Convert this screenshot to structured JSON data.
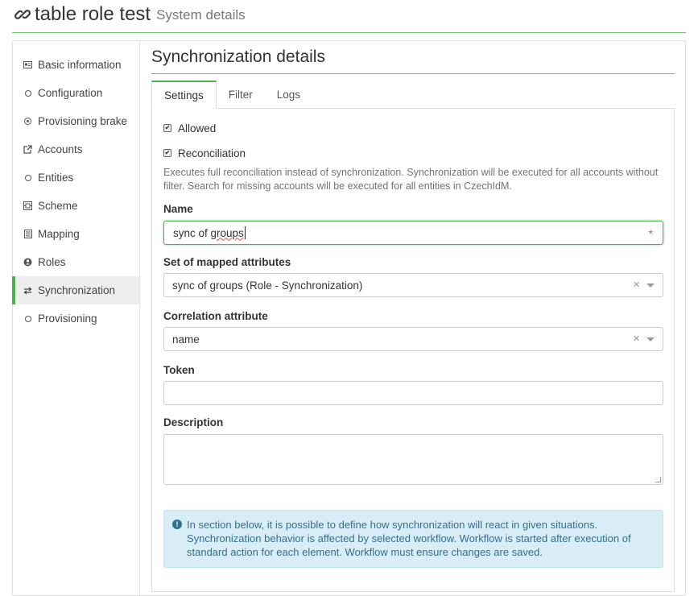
{
  "header": {
    "title": "table role test",
    "subtitle": "System details",
    "icon": "link-icon"
  },
  "sidebar": {
    "items": [
      {
        "label": "Basic information",
        "icon": "id-card-icon"
      },
      {
        "label": "Configuration",
        "icon": "circle-icon"
      },
      {
        "label": "Provisioning brake",
        "icon": "dot-circle-icon"
      },
      {
        "label": "Accounts",
        "icon": "external-link-icon"
      },
      {
        "label": "Entities",
        "icon": "circle-icon"
      },
      {
        "label": "Scheme",
        "icon": "scheme-icon"
      },
      {
        "label": "Mapping",
        "icon": "list-icon"
      },
      {
        "label": "Roles",
        "icon": "roles-icon"
      },
      {
        "label": "Synchronization",
        "icon": "exchange-icon",
        "active": true
      },
      {
        "label": "Provisioning",
        "icon": "circle-icon"
      }
    ]
  },
  "section": {
    "title": "Synchronization details"
  },
  "tabs": [
    {
      "label": "Settings",
      "active": true
    },
    {
      "label": "Filter"
    },
    {
      "label": "Logs"
    }
  ],
  "form": {
    "allowed_label": "Allowed",
    "allowed_checked": true,
    "reconciliation_label": "Reconciliation",
    "reconciliation_checked": true,
    "reconciliation_help": "Executes full reconciliation instead of synchronization. Synchronization will be executed for all accounts without filter. Search for missing accounts will be executed for all entities in CzechIdM.",
    "name_label": "Name",
    "name_value_a": "sync of ",
    "name_value_b": "groups",
    "required_mark": "*",
    "mapped_label": "Set of mapped attributes",
    "mapped_value": "sync of groups (Role - Synchronization)",
    "correlation_label": "Correlation attribute",
    "correlation_value": "name",
    "token_label": "Token",
    "token_value": "",
    "description_label": "Description",
    "description_value": "",
    "clear_symbol": "×"
  },
  "info": {
    "text": "In section below, it is possible to define how synchronization will react in given situations. Synchronization behavior is affected by selected workflow. Workflow is started after execution of standard action for each element. Workflow must ensure changes are saved."
  },
  "colors": {
    "accent": "#4caf50",
    "info_bg": "#d9edf7",
    "info_text": "#31708f",
    "required": "#d9534f"
  }
}
